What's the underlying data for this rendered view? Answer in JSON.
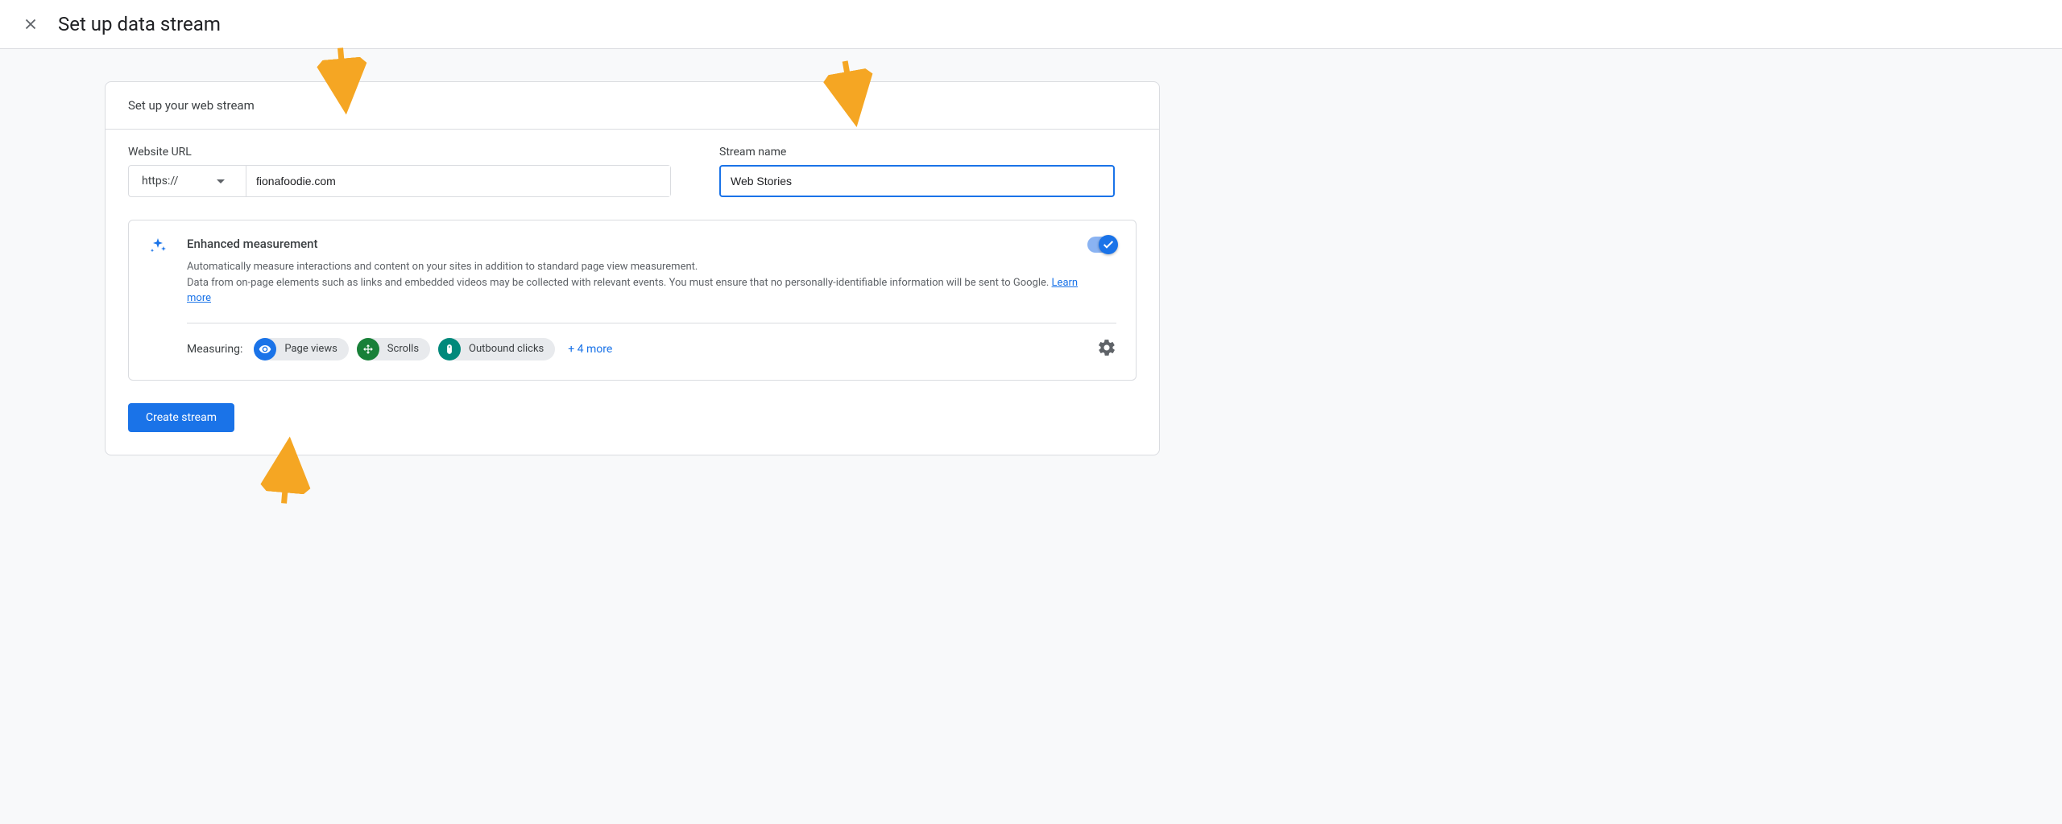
{
  "header": {
    "title": "Set up data stream"
  },
  "card": {
    "subtitle": "Set up your web stream",
    "url_label": "Website URL",
    "protocol": "https://",
    "url_value": "fionafoodie.com",
    "name_label": "Stream name",
    "name_value": "Web Stories"
  },
  "enhanced": {
    "title": "Enhanced measurement",
    "desc_line1": "Automatically measure interactions and content on your sites in addition to standard page view measurement.",
    "desc_line2": "Data from on-page elements such as links and embedded videos may be collected with relevant events. You must ensure that no personally-identifiable information will be sent to Google.",
    "learn_more": "Learn more",
    "measuring_label": "Measuring:",
    "chips": [
      {
        "label": "Page views"
      },
      {
        "label": "Scrolls"
      },
      {
        "label": "Outbound clicks"
      }
    ],
    "more_link": "+ 4 more"
  },
  "button": {
    "create": "Create stream"
  }
}
